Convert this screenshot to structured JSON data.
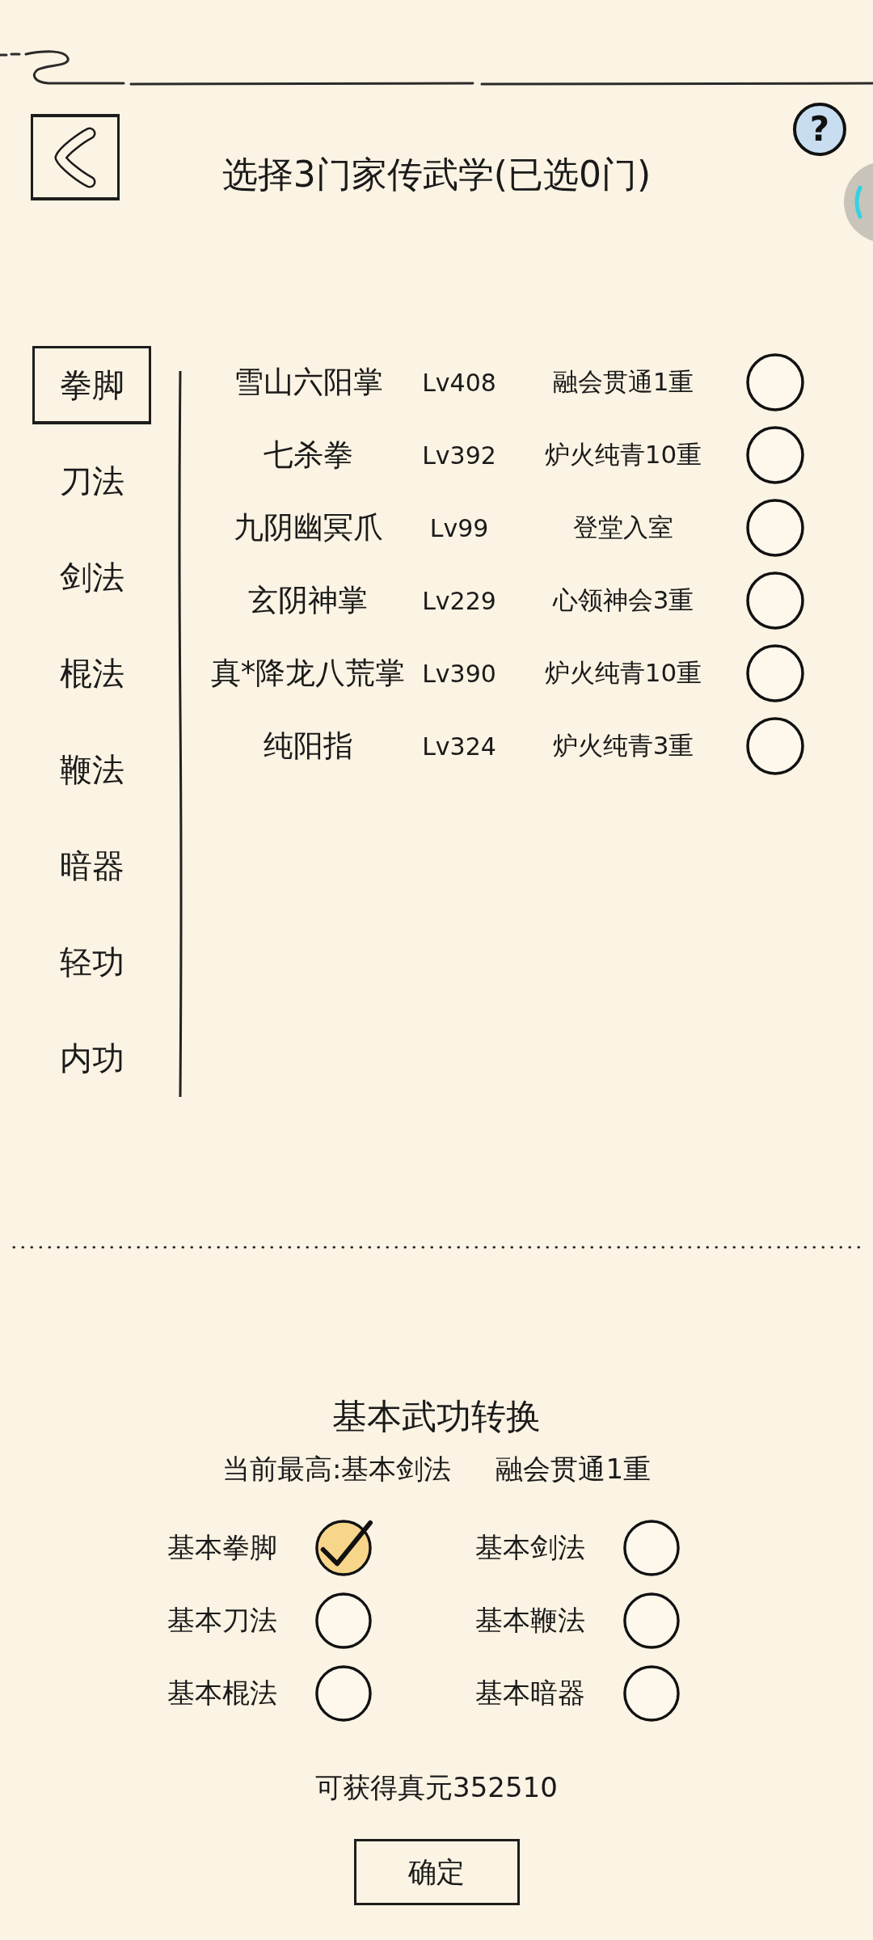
{
  "header": {
    "title": "选择3门家传武学(已选0门)",
    "help_label": "?"
  },
  "categories": [
    {
      "label": "拳脚",
      "selected": true
    },
    {
      "label": "刀法",
      "selected": false
    },
    {
      "label": "剑法",
      "selected": false
    },
    {
      "label": "棍法",
      "selected": false
    },
    {
      "label": "鞭法",
      "selected": false
    },
    {
      "label": "暗器",
      "selected": false
    },
    {
      "label": "轻功",
      "selected": false
    },
    {
      "label": "内功",
      "selected": false
    }
  ],
  "skills": [
    {
      "name": "雪山六阳掌",
      "lv": "Lv408",
      "stage": "融会贯通1重",
      "selected": false
    },
    {
      "name": "七杀拳",
      "lv": "Lv392",
      "stage": "炉火纯青10重",
      "selected": false
    },
    {
      "name": "九阴幽冥爪",
      "lv": "Lv99",
      "stage": "登堂入室",
      "selected": false
    },
    {
      "name": "玄阴神掌",
      "lv": "Lv229",
      "stage": "心领神会3重",
      "selected": false
    },
    {
      "name": "真*降龙八荒掌",
      "lv": "Lv390",
      "stage": "炉火纯青10重",
      "selected": false
    },
    {
      "name": "纯阳指",
      "lv": "Lv324",
      "stage": "炉火纯青3重",
      "selected": false
    }
  ],
  "conversion": {
    "title": "基本武功转换",
    "current_best": "当前最高:基本剑法",
    "current_stage": "融会贯通1重",
    "options": [
      {
        "label": "基本拳脚",
        "checked": true
      },
      {
        "label": "基本剑法",
        "checked": false
      },
      {
        "label": "基本刀法",
        "checked": false
      },
      {
        "label": "基本鞭法",
        "checked": false
      },
      {
        "label": "基本棍法",
        "checked": false
      },
      {
        "label": "基本暗器",
        "checked": false
      }
    ],
    "reward": "可获得真元352510",
    "confirm_label": "确定"
  }
}
